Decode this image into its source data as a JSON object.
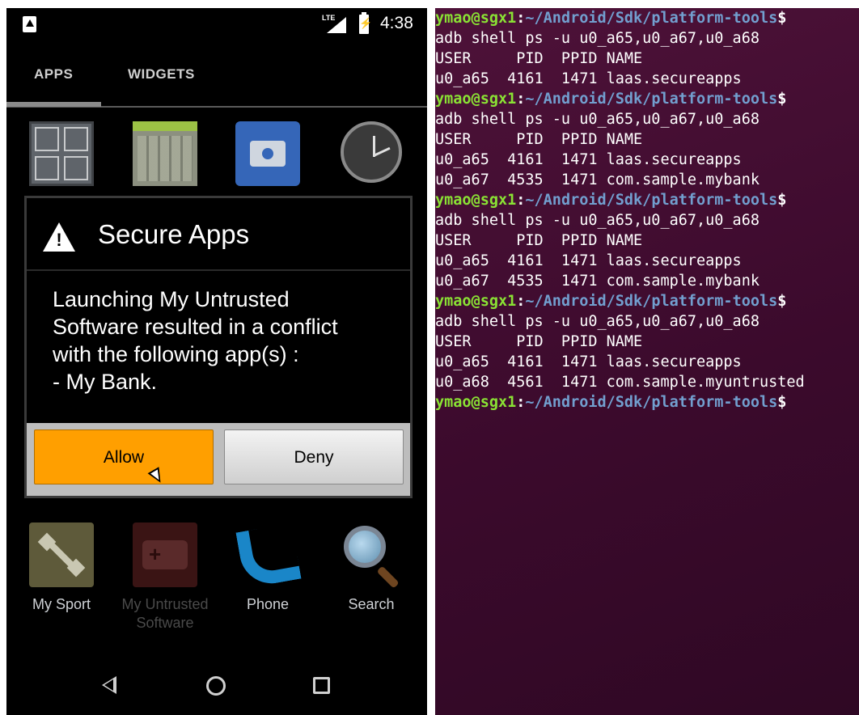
{
  "phone": {
    "status_bar": {
      "network": "LTE",
      "battery_glyph": "⚡",
      "time": "4:38"
    },
    "tabs": [
      {
        "label": "APPS"
      },
      {
        "label": "WIDGETS"
      }
    ],
    "apps_top": [
      {
        "label": "Calculator",
        "icon": "calculator-icon"
      },
      {
        "label": "Calendar",
        "icon": "calendar-icon"
      },
      {
        "label": "Camera",
        "icon": "camera-icon"
      },
      {
        "label": "Clock",
        "icon": "clock-icon"
      }
    ],
    "apps_bottom": [
      {
        "label": "My Sport",
        "icon": "dumbbell-icon"
      },
      {
        "label": "My Untrusted\nSoftware",
        "icon": "gamepad-icon"
      },
      {
        "label": "Phone",
        "icon": "phone-icon"
      },
      {
        "label": "Search",
        "icon": "magnifier-icon"
      }
    ],
    "dialog": {
      "title": "Secure Apps",
      "warning_glyph": "!",
      "message_lines": [
        "Launching My Untrusted",
        "Software resulted in a conflict",
        "with the following app(s) :",
        " - My Bank."
      ],
      "allow_label": "Allow",
      "deny_label": "Deny"
    },
    "colors": {
      "allow": "#ff9f00",
      "deny": "#e6e6e6"
    }
  },
  "terminal": {
    "prompt": {
      "user_host": "ymao@sgx1",
      "path": "~/Android/Sdk/platform-tools",
      "symbol": "$"
    },
    "lines": [
      {
        "type": "prompt"
      },
      {
        "type": "out",
        "text": "adb shell ps -u u0_a65,u0_a67,u0_a68"
      },
      {
        "type": "out",
        "text": "USER     PID  PPID NAME"
      },
      {
        "type": "out",
        "text": "u0_a65  4161  1471 laas.secureapps"
      },
      {
        "type": "prompt"
      },
      {
        "type": "out",
        "text": "adb shell ps -u u0_a65,u0_a67,u0_a68"
      },
      {
        "type": "out",
        "text": "USER     PID  PPID NAME"
      },
      {
        "type": "out",
        "text": "u0_a65  4161  1471 laas.secureapps"
      },
      {
        "type": "out",
        "text": "u0_a67  4535  1471 com.sample.mybank"
      },
      {
        "type": "prompt"
      },
      {
        "type": "out",
        "text": "adb shell ps -u u0_a65,u0_a67,u0_a68"
      },
      {
        "type": "out",
        "text": "USER     PID  PPID NAME"
      },
      {
        "type": "out",
        "text": "u0_a65  4161  1471 laas.secureapps"
      },
      {
        "type": "out",
        "text": "u0_a67  4535  1471 com.sample.mybank"
      },
      {
        "type": "prompt"
      },
      {
        "type": "out",
        "text": "adb shell ps -u u0_a65,u0_a67,u0_a68"
      },
      {
        "type": "out",
        "text": "USER     PID  PPID NAME"
      },
      {
        "type": "out",
        "text": "u0_a65  4161  1471 laas.secureapps"
      },
      {
        "type": "out",
        "text": "u0_a68  4561  1471 com.sample.myuntrusted"
      },
      {
        "type": "prompt"
      }
    ],
    "colors": {
      "background": "#3b0a2c",
      "user_host": "#8ae234",
      "path": "#729fcf"
    }
  }
}
